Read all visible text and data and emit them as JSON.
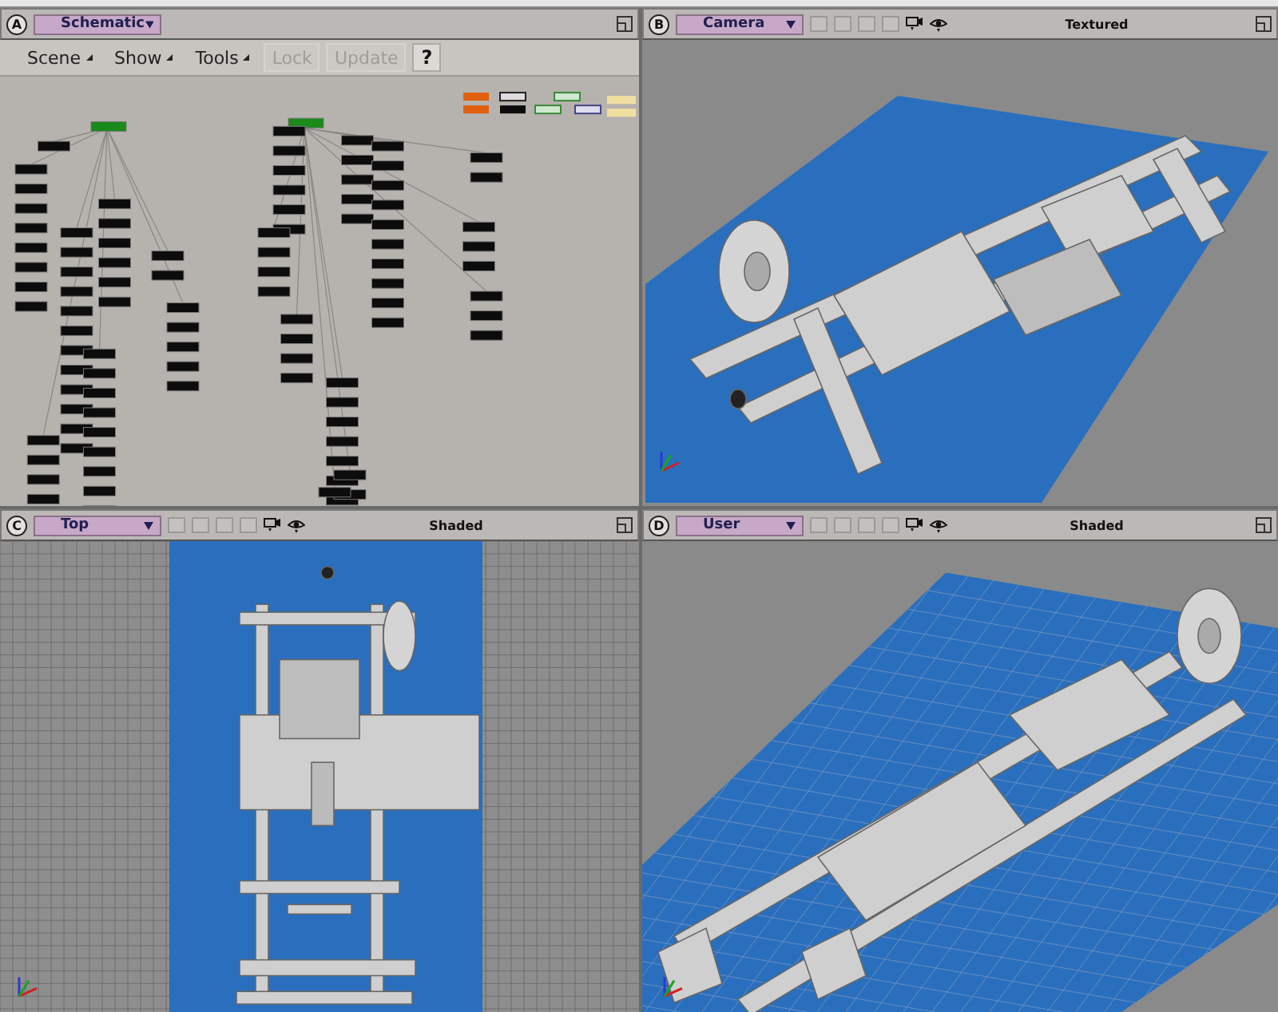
{
  "viewports": [
    {
      "letter": "A",
      "name": "Schematic",
      "kind": "schematic",
      "toolbar": [
        {
          "label": "Scene",
          "kind": "menu",
          "disabled": false
        },
        {
          "label": "Show",
          "kind": "menu",
          "disabled": false
        },
        {
          "label": "Tools",
          "kind": "menu",
          "disabled": false
        },
        {
          "label": "Lock",
          "kind": "button",
          "disabled": true
        },
        {
          "label": "Update",
          "kind": "button",
          "disabled": true
        },
        {
          "label": "?",
          "kind": "help",
          "disabled": false
        }
      ]
    },
    {
      "letter": "B",
      "name": "Camera",
      "kind": "camera",
      "mode": "Textured"
    },
    {
      "letter": "C",
      "name": "Top",
      "kind": "top",
      "mode": "Shaded"
    },
    {
      "letter": "D",
      "name": "User",
      "kind": "user",
      "mode": "Shaded"
    }
  ]
}
